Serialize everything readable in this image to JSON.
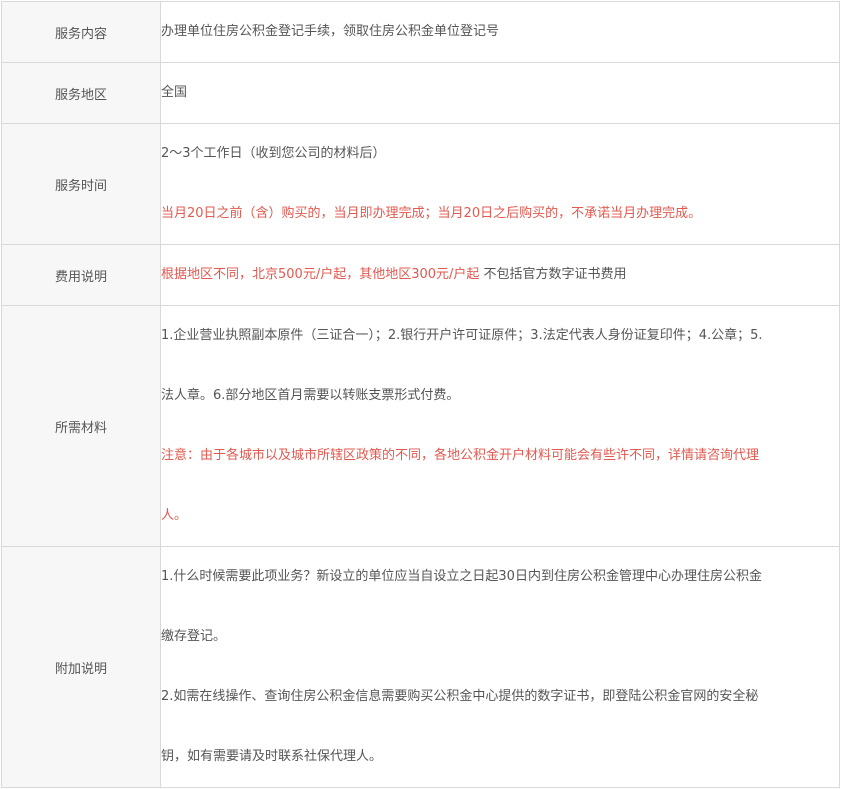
{
  "rows": [
    {
      "label": "服务内容",
      "text": "办理单位住房公积金登记手续，领取住房公积金单位登记号"
    },
    {
      "label": "服务地区",
      "text": "全国"
    },
    {
      "label": "服务时间",
      "line1": "2～3个工作日（收到您公司的材料后）",
      "line2": "当月20日之前（含）购买的，当月即办理完成；当月20日之后购买的，不承诺当月办理完成。"
    },
    {
      "label": "费用说明",
      "red": "根据地区不同，北京500元/户起，其他地区300元/户起",
      "black": " 不包括官方数字证书费用"
    },
    {
      "label": "所需材料",
      "line1": "1.企业营业执照副本原件（三证合一）；2.银行开户许可证原件；3.法定代表人身份证复印件；4.公章；5.",
      "line2": "法人章。6.部分地区首月需要以转账支票形式付费。",
      "line3": "注意：由于各城市以及城市所辖区政策的不同，各地公积金开户材料可能会有些许不同，详情请咨询代理",
      "line4": "人。"
    },
    {
      "label": "附加说明",
      "line1": "1.什么时候需要此项业务？新设立的单位应当自设立之日起30日内到住房公积金管理中心办理住房公积金",
      "line2": "缴存登记。",
      "line3": "2.如需在线操作、查询住房公积金信息需要购买公积金中心提供的数字证书，即登陆公积金官网的安全秘",
      "line4": "钥，如有需要请及时联系社保代理人。"
    }
  ],
  "colors": {
    "red_text": "#e2594f",
    "label_bg": "#f7f7f7",
    "border": "#d9d9d9",
    "text": "#555555"
  }
}
